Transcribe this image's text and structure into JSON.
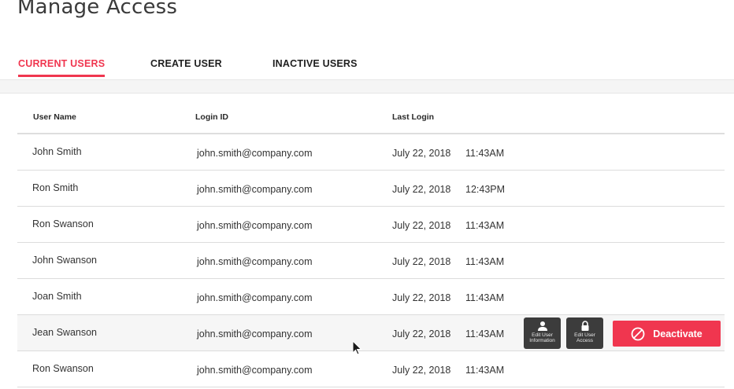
{
  "page": {
    "title": "Manage Access"
  },
  "tabs": [
    {
      "label": "CURRENT USERS",
      "active": true
    },
    {
      "label": "CREATE USER",
      "active": false
    },
    {
      "label": "INACTIVE USERS",
      "active": false
    }
  ],
  "table": {
    "columns": [
      "User Name",
      "Login ID",
      "Last Login"
    ],
    "rows": [
      {
        "name": "John Smith",
        "login": "john.smith@company.com",
        "date": "July 22, 2018",
        "time": "11:43AM"
      },
      {
        "name": "Ron Smith",
        "login": "john.smith@company.com",
        "date": "July 22, 2018",
        "time": "12:43PM"
      },
      {
        "name": "Ron Swanson",
        "login": "john.smith@company.com",
        "date": "July 22, 2018",
        "time": "11:43AM"
      },
      {
        "name": "John Swanson",
        "login": "john.smith@company.com",
        "date": "July 22, 2018",
        "time": "11:43AM"
      },
      {
        "name": "Joan Smith",
        "login": "john.smith@company.com",
        "date": "July 22, 2018",
        "time": "11:43AM"
      },
      {
        "name": "Jean Swanson",
        "login": "john.smith@company.com",
        "date": "July 22, 2018",
        "time": "11:43AM"
      },
      {
        "name": "Ron Swanson",
        "login": "john.smith@company.com",
        "date": "July 22, 2018",
        "time": "11:43AM"
      }
    ]
  },
  "row_actions": {
    "edit_info_label": "Edit User Information",
    "edit_access_label": "Edit User Access",
    "deactivate_label": "Deactivate"
  },
  "colors": {
    "accent": "#f0364f",
    "action_dark": "#3c3c3c"
  },
  "icons": {
    "edit_info": "user-icon",
    "edit_access": "lock-icon",
    "deactivate": "ban-icon"
  }
}
